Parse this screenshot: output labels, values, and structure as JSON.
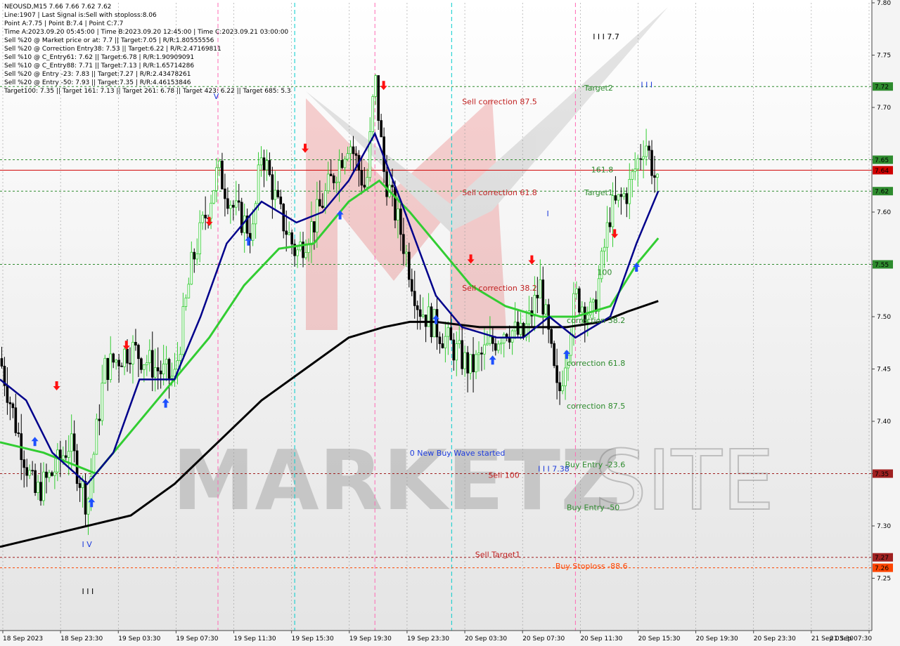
{
  "info": {
    "symbol_line": "NEOUSD,M15  7.66 7.66 7.62 7.62",
    "lines": [
      "Line:1907 | Last Signal is:Sell with stoploss:8.06",
      "Point A:7.75 | Point B:7.4 | Point C:7.7",
      "Time A:2023.09.20 05:45:00 | Time B:2023.09.20 12:45:00 | Time C:2023.09.21 03:00:00",
      "Sell %20 @ Market price or at: 7.7 || Target:7.05 | R/R:1.80555556",
      "Sell %20 @ Correction Entry38: 7.53 || Target:6.22 | R/R:2.47169811",
      "Sell %10 @ C_Entry61: 7.62 || Target:6.78 | R/R:1.90909091",
      "Sell %10 @ C_Entry88: 7.71 || Target:7.13 | R/R:1.65714286",
      "Sell %20 @ Entry -23: 7.83 || Target:7.27 | R/R:2.43478261",
      "Sell %20 @ Entry -50: 7.93 || Target:7.35 | R/R:4.46153846",
      "Target100: 7.35 || Target 161: 7.13 || Target 261: 6.78 || Target 423: 6.22 || Target 685: 5.3"
    ]
  },
  "watermark": {
    "text_left": "MARKETZ",
    "text_right": "SITE"
  },
  "colors": {
    "grid": "#9a9a9a",
    "red_line": "#d00000",
    "green_level": "#2e8b2e",
    "ma_fast": "#00008b",
    "ma_mid": "#32cd32",
    "ma_slow": "#000000",
    "bull_candle": "#32cd32",
    "bear_candle": "#000000",
    "arrow_up": "#1e50ff",
    "arrow_down": "#ff1010",
    "magenta_vline": "#ff69b4",
    "cyan_vline": "#00cccc"
  },
  "chart_data": {
    "type": "candlestick",
    "title": "NEOUSD,M15",
    "ylim": [
      7.2,
      7.8
    ],
    "y_ticks": [
      "7.80",
      "7.75",
      "7.70",
      "7.65",
      "7.60",
      "7.55",
      "7.50",
      "7.45",
      "7.40",
      "7.35",
      "7.30",
      "7.25"
    ],
    "x_ticks": [
      "18 Sep 2023",
      "18 Sep 23:30",
      "19 Sep 03:30",
      "19 Sep 07:30",
      "19 Sep 11:30",
      "19 Sep 15:30",
      "19 Sep 19:30",
      "19 Sep 23:30",
      "20 Sep 03:30",
      "20 Sep 07:30",
      "20 Sep 11:30",
      "20 Sep 15:30",
      "20 Sep 19:30",
      "20 Sep 23:30",
      "21 Sep 03:30",
      "21 Sep 07:30"
    ],
    "last_price": 7.62,
    "price_badges": [
      {
        "value": 7.72,
        "label": "7.72",
        "color": "#2e8b2e"
      },
      {
        "value": 7.65,
        "label": "7.65",
        "color": "#2e8b2e"
      },
      {
        "value": 7.64,
        "label": "7.64",
        "color": "#d00000"
      },
      {
        "value": 7.62,
        "label": "7.62",
        "color": "#2e8b2e"
      },
      {
        "value": 7.55,
        "label": "7.55",
        "color": "#2e8b2e"
      },
      {
        "value": 7.35,
        "label": "7.35",
        "color": "#a02020"
      },
      {
        "value": 7.27,
        "label": "7.27",
        "color": "#a02020"
      },
      {
        "value": 7.26,
        "label": "7.26",
        "color": "#ff4500"
      }
    ],
    "h_levels": [
      {
        "value": 7.72,
        "color": "#2e8b2e",
        "dash": true
      },
      {
        "value": 7.65,
        "color": "#2e8b2e",
        "dash": true
      },
      {
        "value": 7.64,
        "color": "#d00000",
        "dash": false
      },
      {
        "value": 7.62,
        "color": "#2e8b2e",
        "dash": true
      },
      {
        "value": 7.55,
        "color": "#2e8b2e",
        "dash": true
      },
      {
        "value": 7.35,
        "color": "#a02020",
        "dash": true
      },
      {
        "value": 7.27,
        "color": "#a02020",
        "dash": true
      },
      {
        "value": 7.26,
        "color": "#ff4500",
        "dash": true
      }
    ],
    "annotations": [
      {
        "text": "Sell correction 87.5",
        "value": 7.703,
        "x_frac": 0.53,
        "color": "#c02020"
      },
      {
        "text": "Sell correction 61.8",
        "value": 7.616,
        "x_frac": 0.53,
        "color": "#c02020"
      },
      {
        "text": "Sell correction 38.2",
        "value": 7.525,
        "x_frac": 0.53,
        "color": "#c02020"
      },
      {
        "text": "Target2",
        "value": 7.716,
        "x_frac": 0.67,
        "color": "#2e8b2e"
      },
      {
        "text": "161.8",
        "value": 7.638,
        "x_frac": 0.678,
        "color": "#2e8b2e"
      },
      {
        "text": "Target1",
        "value": 7.616,
        "x_frac": 0.67,
        "color": "#2e8b2e"
      },
      {
        "text": "100",
        "value": 7.54,
        "x_frac": 0.685,
        "color": "#2e8b2e"
      },
      {
        "text": "correction 38.2",
        "value": 7.494,
        "x_frac": 0.65,
        "color": "#2e8b2e"
      },
      {
        "text": "correction 61.8",
        "value": 7.453,
        "x_frac": 0.65,
        "color": "#2e8b2e"
      },
      {
        "text": "correction 87.5",
        "value": 7.412,
        "x_frac": 0.65,
        "color": "#2e8b2e"
      },
      {
        "text": "0 New Buy Wave started",
        "value": 7.367,
        "x_frac": 0.47,
        "color": "#1e3cdc"
      },
      {
        "text": "Buy Entry -23.6",
        "value": 7.356,
        "x_frac": 0.648,
        "color": "#2e8b2e"
      },
      {
        "text": "Sell 100",
        "value": 7.346,
        "x_frac": 0.56,
        "color": "#c02020"
      },
      {
        "text": "Buy Entry -50",
        "value": 7.315,
        "x_frac": 0.65,
        "color": "#2e8b2e"
      },
      {
        "text": "Sell Target1",
        "value": 7.27,
        "x_frac": 0.545,
        "color": "#c02020"
      },
      {
        "text": "Buy Stoploss -88.6",
        "value": 7.259,
        "x_frac": 0.637,
        "color": "#ff4500"
      },
      {
        "text": "I I I 7.7",
        "value": 7.765,
        "x_frac": 0.68,
        "color": "#000000",
        "size": 14
      },
      {
        "text": "I I I",
        "value": 7.719,
        "x_frac": 0.735,
        "color": "#1e3cdc",
        "size": 12
      },
      {
        "text": "I I I 7.38",
        "value": 7.352,
        "x_frac": 0.617,
        "color": "#1e3cdc",
        "size": 14
      },
      {
        "text": "I V",
        "value": 7.28,
        "x_frac": 0.094,
        "color": "#1e3cdc",
        "size": 12
      },
      {
        "text": "I I I",
        "value": 7.235,
        "x_frac": 0.094,
        "color": "#000000",
        "size": 12
      },
      {
        "text": "V",
        "value": 7.708,
        "x_frac": 0.245,
        "color": "#1e3cdc",
        "size": 11
      },
      {
        "text": "I",
        "value": 7.596,
        "x_frac": 0.627,
        "color": "#1e3cdc",
        "size": 12
      }
    ],
    "vlines_magenta": [
      0.25,
      0.43,
      0.66
    ],
    "vlines_cyan": [
      0.338,
      0.518
    ],
    "ma_fast_anchors": [
      [
        0,
        7.44
      ],
      [
        0.03,
        7.42
      ],
      [
        0.06,
        7.37
      ],
      [
        0.1,
        7.34
      ],
      [
        0.13,
        7.37
      ],
      [
        0.16,
        7.44
      ],
      [
        0.2,
        7.44
      ],
      [
        0.23,
        7.5
      ],
      [
        0.26,
        7.57
      ],
      [
        0.3,
        7.61
      ],
      [
        0.34,
        7.59
      ],
      [
        0.37,
        7.6
      ],
      [
        0.4,
        7.63
      ],
      [
        0.43,
        7.675
      ],
      [
        0.46,
        7.61
      ],
      [
        0.5,
        7.52
      ],
      [
        0.53,
        7.49
      ],
      [
        0.57,
        7.48
      ],
      [
        0.6,
        7.48
      ],
      [
        0.63,
        7.5
      ],
      [
        0.66,
        7.48
      ],
      [
        0.7,
        7.5
      ],
      [
        0.73,
        7.57
      ],
      [
        0.755,
        7.62
      ]
    ],
    "ma_mid_anchors": [
      [
        0,
        7.38
      ],
      [
        0.05,
        7.37
      ],
      [
        0.11,
        7.35
      ],
      [
        0.15,
        7.39
      ],
      [
        0.2,
        7.44
      ],
      [
        0.24,
        7.48
      ],
      [
        0.28,
        7.53
      ],
      [
        0.32,
        7.565
      ],
      [
        0.36,
        7.57
      ],
      [
        0.4,
        7.61
      ],
      [
        0.435,
        7.63
      ],
      [
        0.47,
        7.6
      ],
      [
        0.5,
        7.57
      ],
      [
        0.54,
        7.53
      ],
      [
        0.58,
        7.51
      ],
      [
        0.62,
        7.5
      ],
      [
        0.66,
        7.5
      ],
      [
        0.7,
        7.51
      ],
      [
        0.73,
        7.55
      ],
      [
        0.755,
        7.575
      ]
    ],
    "ma_slow_anchors": [
      [
        0,
        7.28
      ],
      [
        0.05,
        7.29
      ],
      [
        0.1,
        7.3
      ],
      [
        0.15,
        7.31
      ],
      [
        0.2,
        7.34
      ],
      [
        0.25,
        7.38
      ],
      [
        0.3,
        7.42
      ],
      [
        0.35,
        7.45
      ],
      [
        0.4,
        7.48
      ],
      [
        0.44,
        7.49
      ],
      [
        0.47,
        7.495
      ],
      [
        0.5,
        7.495
      ],
      [
        0.55,
        7.49
      ],
      [
        0.6,
        7.49
      ],
      [
        0.65,
        7.49
      ],
      [
        0.69,
        7.495
      ],
      [
        0.72,
        7.505
      ],
      [
        0.755,
        7.515
      ]
    ],
    "candles_path": [
      [
        0,
        7.46
      ],
      [
        0.02,
        7.39
      ],
      [
        0.04,
        7.33
      ],
      [
        0.06,
        7.35
      ],
      [
        0.08,
        7.38
      ],
      [
        0.1,
        7.32
      ],
      [
        0.12,
        7.45
      ],
      [
        0.15,
        7.47
      ],
      [
        0.18,
        7.45
      ],
      [
        0.2,
        7.44
      ],
      [
        0.22,
        7.55
      ],
      [
        0.25,
        7.64
      ],
      [
        0.27,
        7.6
      ],
      [
        0.29,
        7.58
      ],
      [
        0.3,
        7.66
      ],
      [
        0.32,
        7.6
      ],
      [
        0.34,
        7.56
      ],
      [
        0.36,
        7.59
      ],
      [
        0.38,
        7.63
      ],
      [
        0.4,
        7.67
      ],
      [
        0.42,
        7.62
      ],
      [
        0.43,
        7.73
      ],
      [
        0.44,
        7.64
      ],
      [
        0.46,
        7.58
      ],
      [
        0.48,
        7.51
      ],
      [
        0.5,
        7.49
      ],
      [
        0.52,
        7.47
      ],
      [
        0.54,
        7.45
      ],
      [
        0.56,
        7.47
      ],
      [
        0.58,
        7.49
      ],
      [
        0.6,
        7.48
      ],
      [
        0.62,
        7.53
      ],
      [
        0.64,
        7.42
      ],
      [
        0.66,
        7.52
      ],
      [
        0.68,
        7.5
      ],
      [
        0.7,
        7.6
      ],
      [
        0.72,
        7.62
      ],
      [
        0.74,
        7.67
      ],
      [
        0.755,
        7.62
      ]
    ]
  }
}
